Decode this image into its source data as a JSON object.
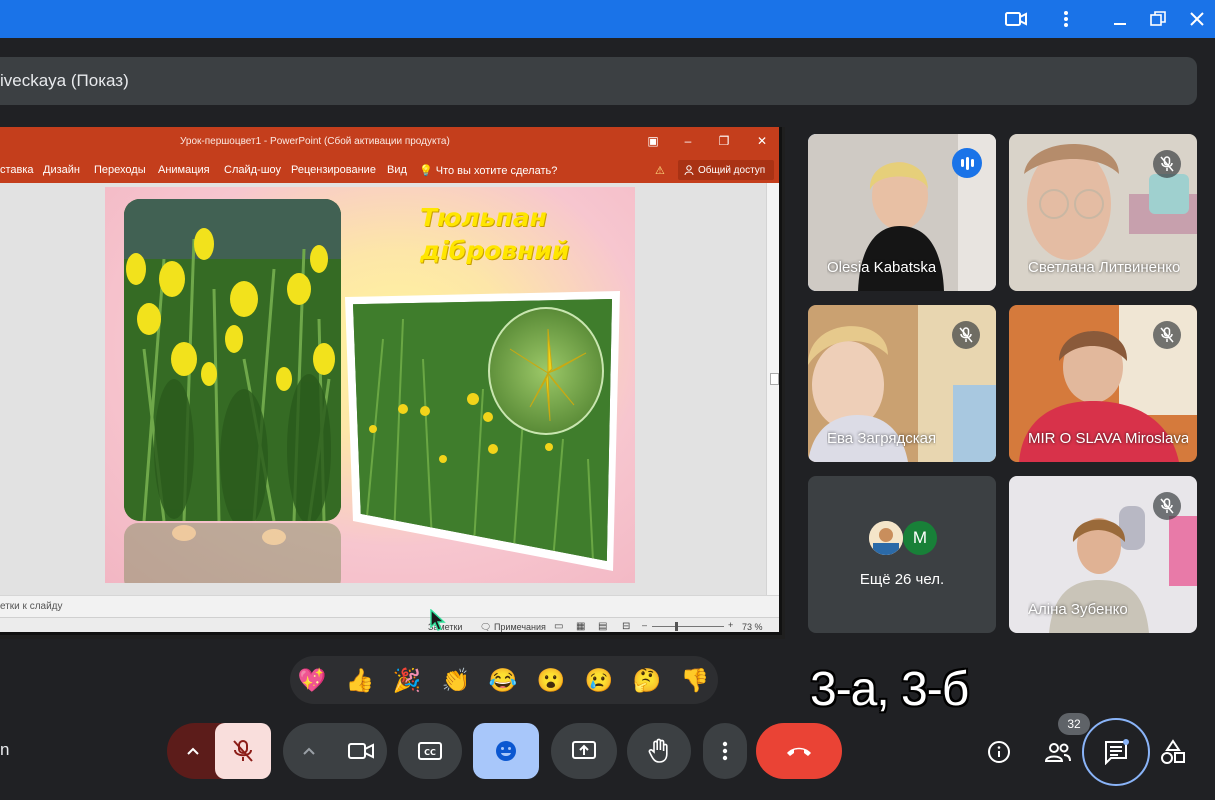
{
  "window": {
    "controls": [
      "meet-window-icon",
      "more-vert-icon",
      "minimize-icon",
      "restore-icon",
      "close-icon"
    ]
  },
  "meeting": {
    "title": "iveckaya (Показ)"
  },
  "powerpoint": {
    "doc_title": "Урок-першоцвет1 - PowerPoint (Сбой активации продукта)",
    "ribbon_tabs": [
      "ставка",
      "Дизайн",
      "Переходы",
      "Анимация",
      "Слайд-шоу",
      "Рецензирование",
      "Вид"
    ],
    "tell_me": "Что вы хотите сделать?",
    "share_label": "Общий доступ",
    "notes_placeholder": "етки к слайду",
    "status_notes": "Заметки",
    "status_comments": "Примечания",
    "zoom": "73 %",
    "slide": {
      "title_line1": "Тюльпан",
      "title_line2": "дібровний"
    }
  },
  "participants": [
    {
      "name": "Olesia Kabatska",
      "speaking": true,
      "muted": false
    },
    {
      "name": "Светлана Литвиненко",
      "speaking": false,
      "muted": true
    },
    {
      "name": "Ева Загрядская",
      "speaking": false,
      "muted": true
    },
    {
      "name": "MIR O SLAVA Miroslava",
      "speaking": false,
      "muted": true
    },
    {
      "name": "Аліна Зубенко",
      "speaking": false,
      "muted": true
    }
  ],
  "others_tile": {
    "label": "Ещё 26 чел.",
    "avatar_letter": "M",
    "avatar_color": "#188038"
  },
  "reactions": [
    "💖",
    "👍",
    "🎉",
    "👏",
    "😂",
    "😮",
    "😢",
    "🤔",
    "👎"
  ],
  "caption_overlay": "3-а, 3-б",
  "controls": {
    "mic": {
      "state": "off",
      "color": "#f9dedc"
    },
    "camera": "camera-icon",
    "captions": "closed-captions-icon",
    "emoji": {
      "active": true,
      "color": "#a8c7fa"
    },
    "present": "present-screen-icon",
    "raise_hand": "raise-hand-icon",
    "more": "more-vert-icon",
    "leave": {
      "color": "#ea4335"
    }
  },
  "right_controls": {
    "people_count": "32",
    "icons": [
      "info-icon",
      "people-icon",
      "chat-icon",
      "activities-icon"
    ]
  },
  "colors": {
    "titlebar": "#1a73e8",
    "background": "#202124",
    "ppt_accent": "#c43e1c",
    "speaking_outline": "#8ab4f8"
  },
  "bottom_left_partial": "n"
}
